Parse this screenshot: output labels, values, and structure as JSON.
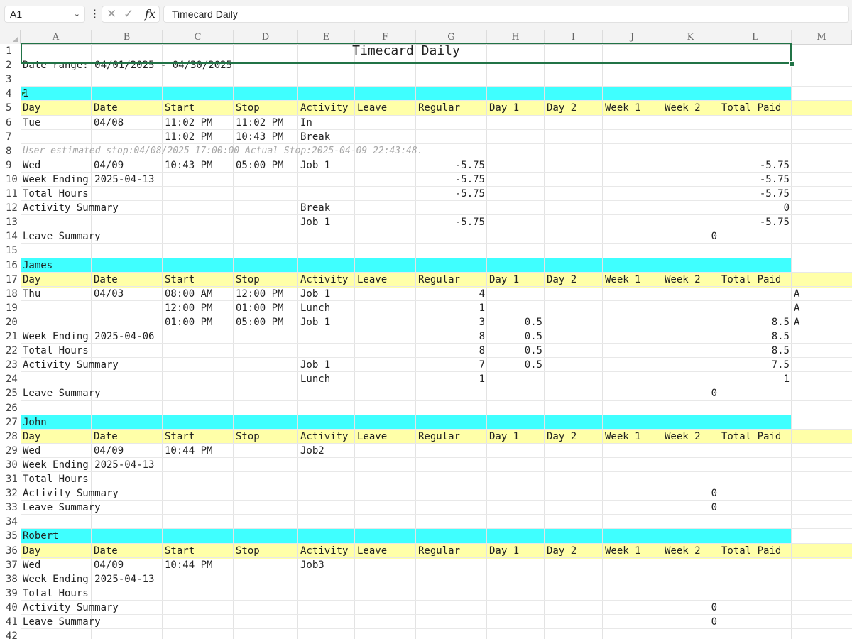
{
  "formula_bar": {
    "name_box": "A1",
    "formula": "Timecard Daily",
    "more_icon": "vertical-ellipsis",
    "cancel_icon": "x-mark",
    "enter_icon": "check-mark",
    "fx_label": "fx"
  },
  "columns": [
    "A",
    "B",
    "C",
    "D",
    "E",
    "F",
    "G",
    "H",
    "I",
    "J",
    "K",
    "L",
    "M"
  ],
  "rows": [
    "1",
    "2",
    "3",
    "4",
    "5",
    "6",
    "7",
    "8",
    "9",
    "10",
    "11",
    "12",
    "13",
    "14",
    "15",
    "16",
    "17",
    "18",
    "19",
    "20",
    "21",
    "22",
    "23",
    "24",
    "25",
    "26",
    "27",
    "28",
    "29",
    "30",
    "31",
    "32",
    "33",
    "34",
    "35",
    "36",
    "37",
    "38",
    "39",
    "40",
    "41",
    "42"
  ],
  "colors": {
    "section_header": "#3fffff",
    "column_header_row": "#ffffa8",
    "selection": "#217346"
  },
  "sheet": {
    "title": "Timecard Daily",
    "date_range": "Date range: 04/01/2025 - 04/30/2025",
    "headers": [
      "Day",
      "Date",
      "Start",
      "Stop",
      "Activity",
      "Leave",
      "Regular",
      "Day 1",
      "Day 2",
      "Week 1",
      "Week 2",
      "Total Paid"
    ],
    "s1": {
      "name": "1",
      "r6": [
        "Tue",
        "04/08",
        "11:02 PM",
        "11:02 PM",
        "In"
      ],
      "r7": [
        "11:02 PM",
        "10:43 PM",
        "Break"
      ],
      "note": "User estimated stop:04/08/2025 17:00:00  Actual Stop:2025-04-09 22:43:48.",
      "r9": [
        "Wed",
        "04/09",
        "10:43 PM",
        "05:00 PM",
        "Job 1",
        "-5.75",
        "-5.75"
      ],
      "week_ending": "Week Ending 2025-04-13",
      "we_regular": "-5.75",
      "we_total": "-5.75",
      "total_hours": "Total Hours",
      "th_regular": "-5.75",
      "th_total": "-5.75",
      "activity_summary": "Activity Summary",
      "as1": [
        "Break",
        "0"
      ],
      "as2": [
        "Job 1",
        "-5.75",
        "-5.75"
      ],
      "leave_summary": "Leave Summary",
      "ls_value": "0"
    },
    "s2": {
      "name": "James",
      "r18": [
        "Thu",
        "04/03",
        "08:00 AM",
        "12:00 PM",
        "Job 1",
        "4",
        "A"
      ],
      "r19": [
        "12:00 PM",
        "01:00 PM",
        "Lunch",
        "1",
        "A"
      ],
      "r20": [
        "01:00 PM",
        "05:00 PM",
        "Job 1",
        "3",
        "0.5",
        "8.5",
        "A"
      ],
      "week_ending": "Week Ending 2025-04-06",
      "we": [
        "8",
        "0.5",
        "8.5"
      ],
      "total_hours": "Total Hours",
      "th": [
        "8",
        "0.5",
        "8.5"
      ],
      "activity_summary": "Activity Summary",
      "as1": [
        "Job 1",
        "7",
        "0.5",
        "7.5"
      ],
      "as2": [
        "Lunch",
        "1",
        "1"
      ],
      "leave_summary": "Leave Summary",
      "ls_value": "0"
    },
    "s3": {
      "name": "John",
      "r29": [
        "Wed",
        "04/09",
        "10:44 PM",
        "Job2"
      ],
      "week_ending": "Week Ending 2025-04-13",
      "total_hours": "Total Hours",
      "activity_summary": "Activity Summary",
      "as_value": "0",
      "leave_summary": "Leave Summary",
      "ls_value": "0"
    },
    "s4": {
      "name": "Robert",
      "r37": [
        "Wed",
        "04/09",
        "10:44 PM",
        "Job3"
      ],
      "week_ending": "Week Ending 2025-04-13",
      "total_hours": "Total Hours",
      "activity_summary": "Activity Summary",
      "as_value": "0",
      "leave_summary": "Leave Summary",
      "ls_value": "0"
    }
  }
}
